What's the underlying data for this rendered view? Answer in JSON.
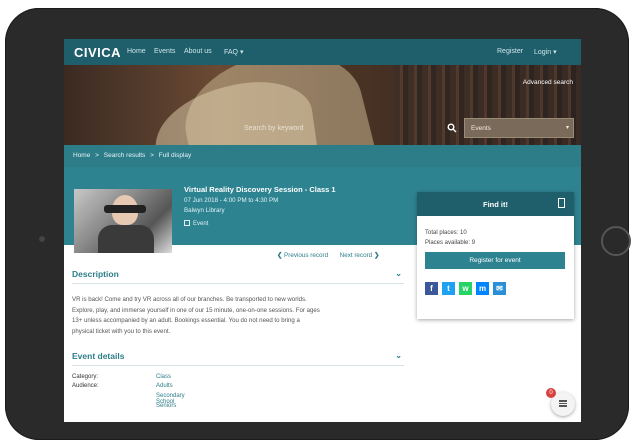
{
  "navbar": {
    "logo": "CIVICA",
    "items": [
      "Home",
      "Events",
      "About us",
      "FAQ ▾"
    ],
    "register": "Register",
    "login": "Login ▾"
  },
  "search": {
    "advanced": "Advanced search",
    "placeholder": "Search by keyword",
    "scope": "Events"
  },
  "breadcrumb": {
    "home": "Home",
    "results": "Search results",
    "current": "Full display",
    "sep": ">"
  },
  "record": {
    "title": "Virtual Reality Discovery Session - Class 1",
    "datetime": "07 Jun 2018 - 4:00 PM to 4:30 PM",
    "location": "Balwyn Library",
    "type": "Event",
    "prev": "Previous record",
    "next": "Next record"
  },
  "description": {
    "heading": "Description",
    "lines": [
      "VR is back! Come and try VR across all of our branches. Be transported to new worlds.",
      "Explore, play, and immerse yourself in one of our 15 minute, one-on-one sessions. For ages",
      "13+ unless accompanied by an adult. Bookings essential. You do not need to bring a",
      "physical ticket with you to this event."
    ]
  },
  "event_details": {
    "heading": "Event details",
    "category_label": "Category:",
    "category_value": "Class",
    "audience_label": "Audience:",
    "audience_values": [
      "Adults",
      "Secondary School",
      "Seniors"
    ]
  },
  "find_it": {
    "heading": "Find it!",
    "total_places": "Total places: 10",
    "places_available": "Places available: 9",
    "register_button": "Register for event",
    "share": [
      {
        "name": "facebook",
        "glyph": "f",
        "color": "#3b5998"
      },
      {
        "name": "twitter",
        "glyph": "t",
        "color": "#1da1f2"
      },
      {
        "name": "whatsapp",
        "glyph": "w",
        "color": "#25d366"
      },
      {
        "name": "messenger",
        "glyph": "m",
        "color": "#0084ff"
      },
      {
        "name": "email",
        "glyph": "✉",
        "color": "#2a8fd6"
      }
    ]
  },
  "chat": {
    "badge": "0"
  },
  "colors": {
    "nav": "#1f5f6b",
    "accent": "#2e8391",
    "link": "#2d7d89"
  }
}
